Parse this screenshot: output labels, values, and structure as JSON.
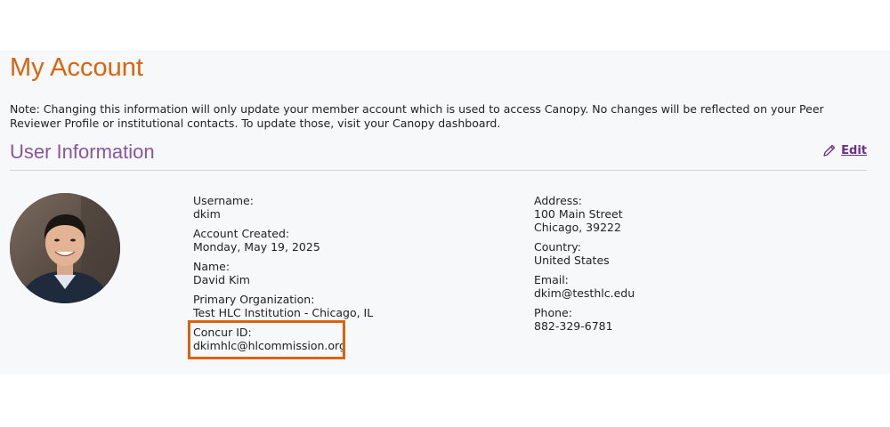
{
  "page": {
    "title": "My Account",
    "note": "Note: Changing this information will only update your member account which is used to access Canopy. No changes will be reflected on your Peer Reviewer Profile or institutional contacts. To update those, visit your Canopy dashboard."
  },
  "section": {
    "title": "User Information",
    "edit_label": "Edit"
  },
  "user_left": [
    {
      "label": "Username:",
      "value": "dkim"
    },
    {
      "label": "Account Created:",
      "value": "Monday, May 19, 2025"
    },
    {
      "label": "Name:",
      "value": "David Kim"
    },
    {
      "label": "Primary Organization:",
      "value": "Test HLC Institution - Chicago, IL"
    },
    {
      "label": "Concur ID:",
      "value": "dkimhlc@hlcommission.org"
    }
  ],
  "user_right": [
    {
      "label": "Address:",
      "value": "100 Main Street",
      "value2": "Chicago, 39222"
    },
    {
      "label": "Country:",
      "value": "United States"
    },
    {
      "label": "Email:",
      "value": "dkim@testhlc.edu"
    },
    {
      "label": "Phone:",
      "value": "882-329-6781"
    }
  ],
  "colors": {
    "accent_orange": "#d9640b",
    "section_purple": "#8a55a0",
    "link_purple": "#6b2f86"
  },
  "icons": {
    "edit": "pencil-icon"
  }
}
